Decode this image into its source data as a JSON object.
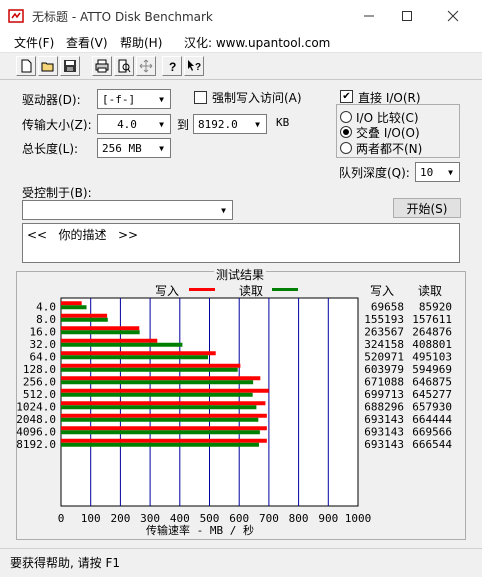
{
  "window": {
    "title": "无标题 - ATTO Disk Benchmark"
  },
  "menu": [
    {
      "label": "文件(F)"
    },
    {
      "label": "查看(V)"
    },
    {
      "label": "帮助(H)"
    },
    {
      "label": "汉化: www.upantool.com"
    }
  ],
  "toolbar": {
    "icons": [
      "new-document-icon",
      "open-folder-icon",
      "save-icon",
      "print-icon",
      "print-preview-icon",
      "move-icon",
      "help-icon",
      "context-help-icon"
    ]
  },
  "settings": {
    "drive_label": "驱动器(D):",
    "drive_value": "[-f-]",
    "force_write_label": "强制写入访问(A)",
    "force_write_checked": false,
    "transfer_size_label": "传输大小(Z):",
    "transfer_from": "4.0",
    "to_label": "到",
    "transfer_to": "8192.0",
    "kb_unit": "KB",
    "total_length_label": "总长度(L):",
    "total_length_value": "256 MB",
    "direct_io_label": "直接 I/O(R)",
    "direct_io_checked": true,
    "io_options": [
      {
        "label": "I/O 比较(C)",
        "selected": false
      },
      {
        "label": "交叠 I/O(O)",
        "selected": true
      },
      {
        "label": "两者都不(N)",
        "selected": false
      }
    ],
    "queue_depth_label": "队列深度(Q):",
    "queue_depth_value": "10",
    "controlled_by_label": "受控制于(B):",
    "controlled_by_value": "",
    "start_button": "开始(S)",
    "description_text": "<<   你的描述   >>"
  },
  "results": {
    "title": "测试结果",
    "legend_write": "写入",
    "legend_read": "读取",
    "col_write": "写入",
    "col_read": "读取",
    "xlabel": "传输速率 - MB / 秒",
    "colors": {
      "write": "#ff0000",
      "read": "#008000",
      "grid": "#0000a0"
    }
  },
  "chart_data": {
    "type": "bar",
    "orientation": "horizontal",
    "categories": [
      "4.0",
      "8.0",
      "16.0",
      "32.0",
      "64.0",
      "128.0",
      "256.0",
      "512.0",
      "1024.0",
      "2048.0",
      "4096.0",
      "8192.0"
    ],
    "series": [
      {
        "name": "写入",
        "values": [
          69658,
          155193,
          263567,
          324158,
          520971,
          603979,
          671088,
          699713,
          688296,
          693143,
          693143,
          693143
        ]
      },
      {
        "name": "读取",
        "values": [
          85920,
          157611,
          264876,
          408801,
          495103,
          594969,
          646875,
          645277,
          657930,
          664444,
          669566,
          666544
        ]
      }
    ],
    "xticks": [
      "0",
      "100",
      "200",
      "300",
      "400",
      "500",
      "600",
      "700",
      "800",
      "900",
      "1000"
    ],
    "xlim": [
      0,
      1000
    ],
    "xlabel": "传输速率 - MB / 秒",
    "grid": true
  },
  "status": {
    "text": "要获得帮助, 请按 F1"
  }
}
